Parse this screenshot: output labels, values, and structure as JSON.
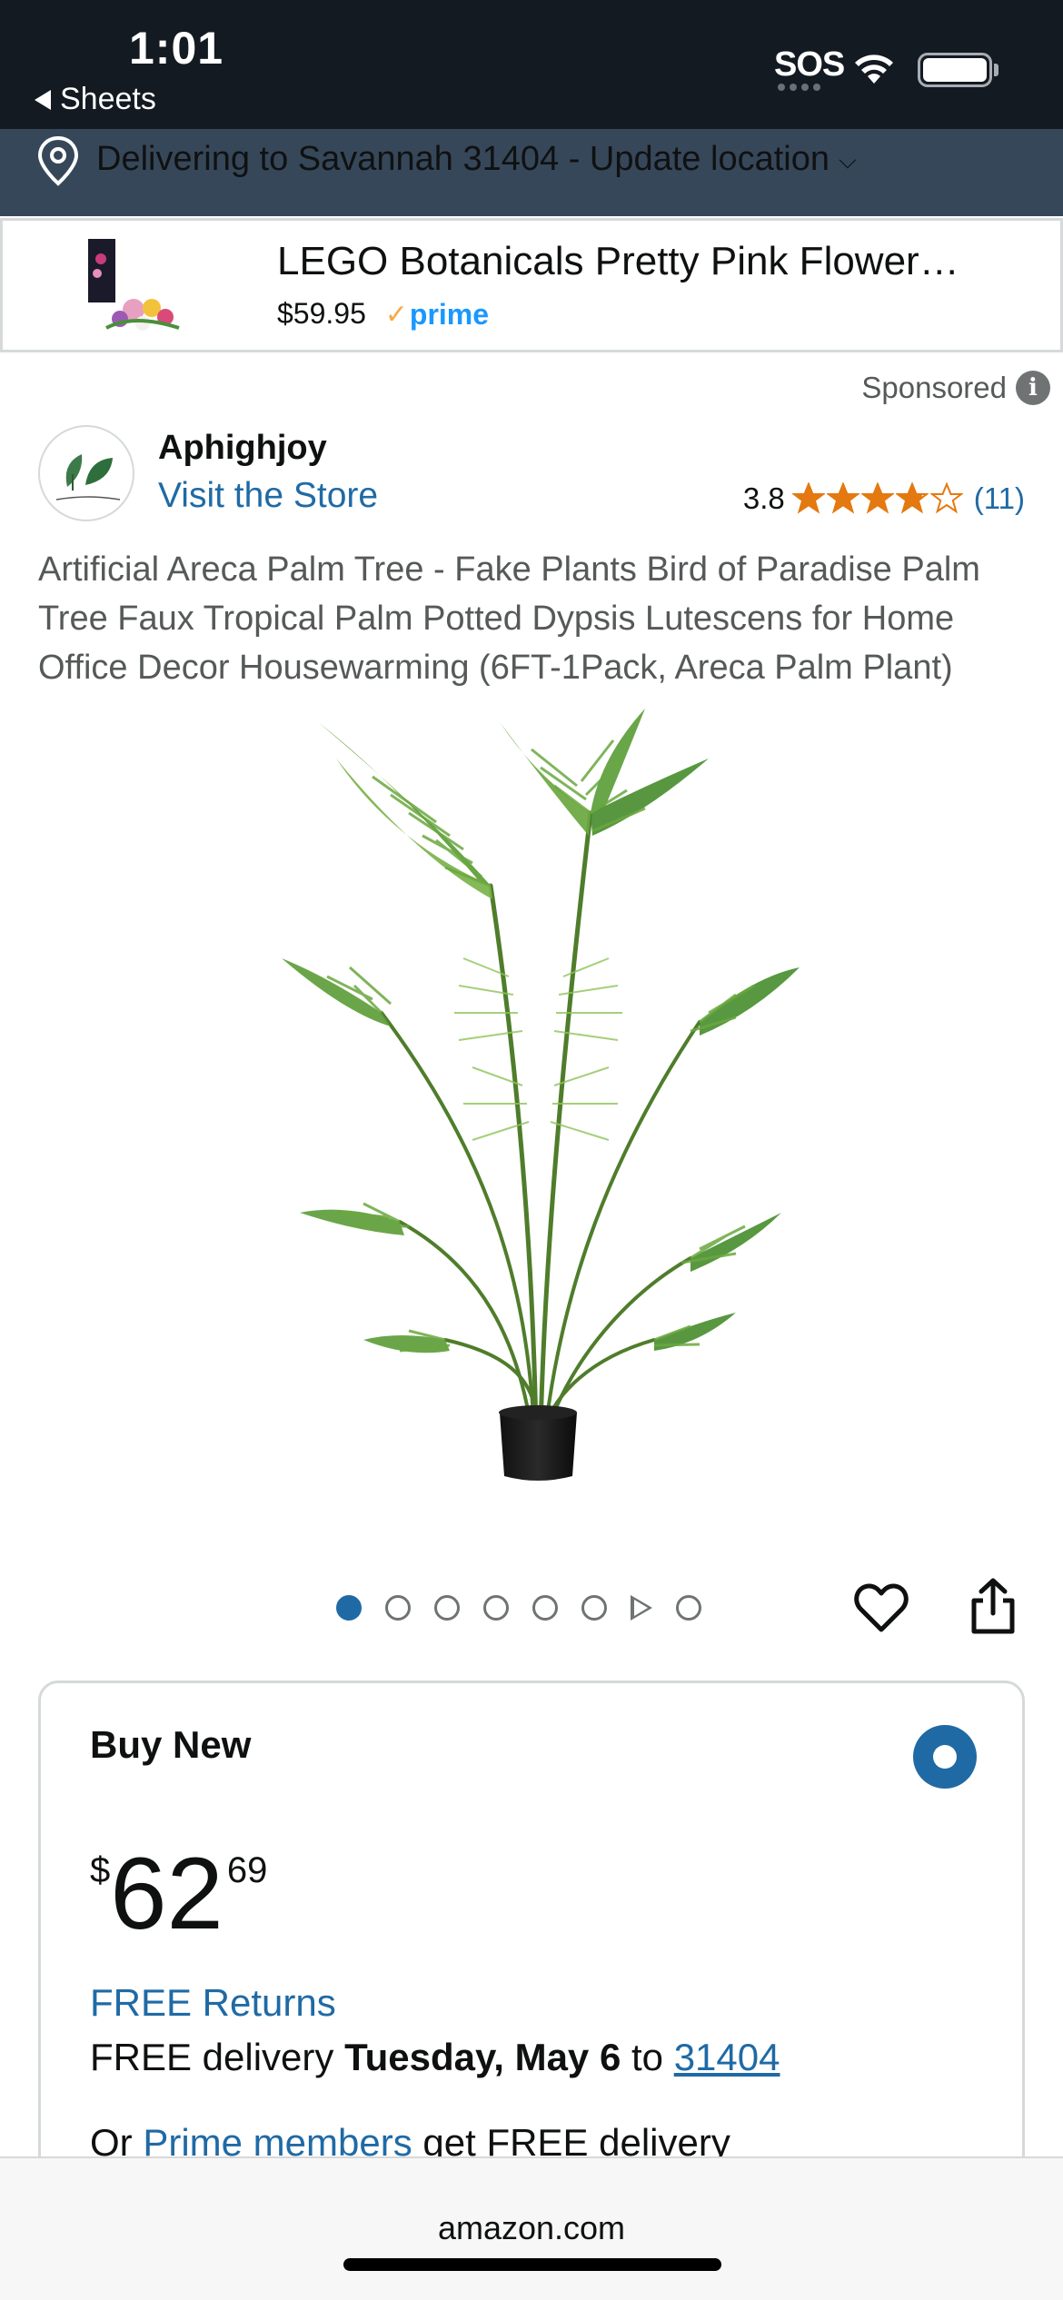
{
  "status_bar": {
    "time": "1:01",
    "back_label": "Sheets",
    "sos": "SOS"
  },
  "location": {
    "text": "Delivering to Savannah 31404 - Update location"
  },
  "promo": {
    "title": "LEGO Botanicals Pretty Pink Flower…",
    "price": "$59.95",
    "prime_label": "prime"
  },
  "sponsored_label": "Sponsored",
  "brand": {
    "name": "Aphighjoy",
    "store_link": "Visit the Store",
    "rating": "3.8",
    "review_count": "(11)",
    "stars_filled": 3.8,
    "stars_total": 5
  },
  "product": {
    "title": "Artificial Areca Palm Tree - Fake Plants Bird of Paradise Palm Tree Faux Tropical Palm Potted Dypsis Lutescens for Home Office Decor Housewarming (6FT-1Pack, Areca Palm Plant)"
  },
  "carousel": {
    "active_index": 0,
    "items": [
      "image",
      "image",
      "image",
      "image",
      "image",
      "image",
      "video",
      "image"
    ]
  },
  "buy_box": {
    "heading": "Buy New",
    "price_symbol": "$",
    "price_whole": "62",
    "price_fraction": "69",
    "free_returns": "FREE Returns",
    "delivery_prefix": "FREE delivery ",
    "delivery_date": "Tuesday, May 6",
    "delivery_to": " to ",
    "delivery_zip": "31404",
    "prime_prefix": "Or ",
    "prime_link": "Prime members",
    "prime_suffix": " get FREE delivery"
  },
  "url_bar": {
    "domain": "amazon.com"
  },
  "colors": {
    "header_dark": "#131a22",
    "location_bar": "#37475a",
    "link_blue": "#1f6aa5",
    "star_orange": "#e47911",
    "prime_blue": "#1a98ff"
  }
}
